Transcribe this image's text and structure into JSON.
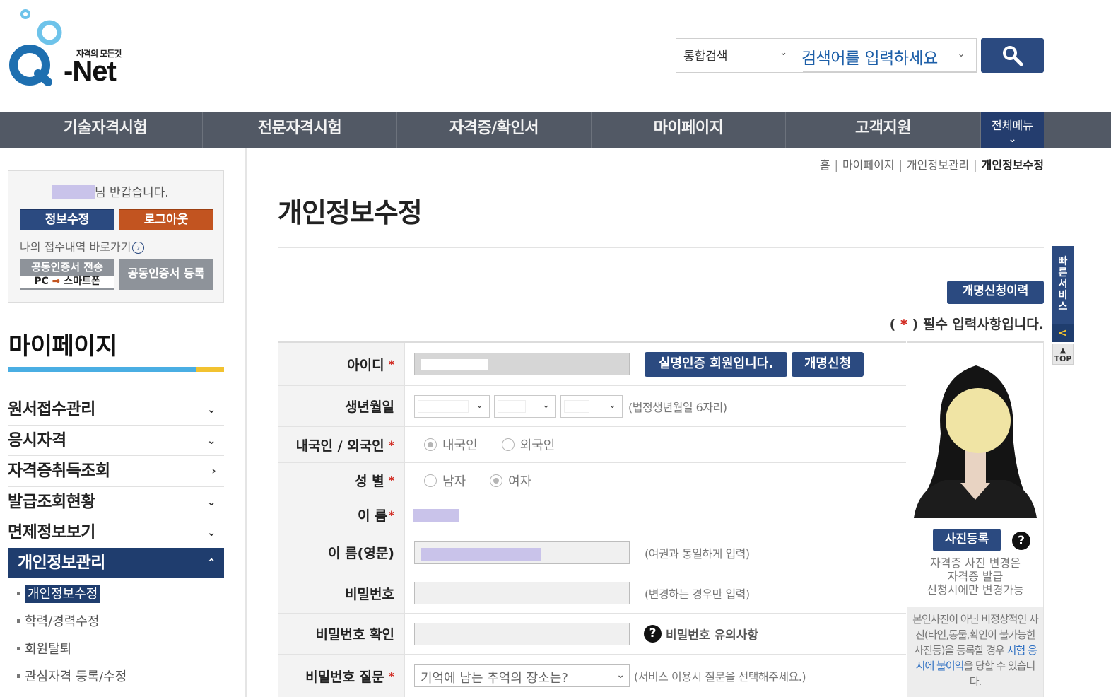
{
  "header": {
    "logo_tag": "자격의 모든것",
    "logo_word": "-Net",
    "search_scope": "통합검색",
    "search_placeholder": "검색어를 입력하세요"
  },
  "gnb": {
    "items": [
      "기술자격시험",
      "전문자격시험",
      "자격증/확인서",
      "마이페이지",
      "고객지원"
    ],
    "all_menu": "전체메뉴"
  },
  "sidebar": {
    "greeting_suffix": "님 반갑습니다.",
    "info_button": "정보수정",
    "logout_button": "로그아웃",
    "receipt_link": "나의 접수내역 바로가기",
    "cert_send_top": "공동인증서 전송",
    "cert_send_pc": "PC",
    "cert_send_phone": "스마트폰",
    "cert_register": "공동인증서 등록",
    "title": "마이페이지",
    "menu": [
      {
        "label": "원서접수관리",
        "chev": "⌄"
      },
      {
        "label": "응시자격",
        "chev": "⌄"
      },
      {
        "label": "자격증취득조회",
        "chev": "›"
      },
      {
        "label": "발급조회현황",
        "chev": "⌄"
      },
      {
        "label": "면제정보보기",
        "chev": "⌄"
      },
      {
        "label": "개인정보관리",
        "chev": "⌃"
      }
    ],
    "submenu": [
      "개인정보수정",
      "학력/경력수정",
      "회원탈퇴",
      "관심자격 등록/수정"
    ]
  },
  "breadcrumb": [
    "홈",
    "마이페이지",
    "개인정보관리",
    "개인정보수정"
  ],
  "page_title": "개인정보수정",
  "rename_history_button": "개명신청이력",
  "required_note": {
    "open": "( ",
    "star": "*",
    "close": " ) 필수 입력사항입니다."
  },
  "form": {
    "id_label": "아이디",
    "real_name_button": "실명인증 회원입니다.",
    "rename_button": "개명신청",
    "birth_label": "생년월일",
    "birth_hint": "(법정생년월일 6자리)",
    "nationality_label": "내국인 / 외국인",
    "nationality_options": [
      "내국인",
      "외국인"
    ],
    "gender_label": "성 별",
    "gender_options": [
      "남자",
      "여자"
    ],
    "name_label": "이 름",
    "name_en_label": "이 름(영문)",
    "name_en_hint": "(여권과 동일하게 입력)",
    "password_label": "비밀번호",
    "password_hint": "(변경하는 경우만 입력)",
    "password_confirm_label": "비밀번호 확인",
    "password_caution": "비밀번호 유의사항",
    "password_question_label": "비밀번호 질문",
    "password_question_value": "기억에 남는 추억의 장소는?",
    "password_question_hint": "(서비스 이용시 질문을 선택해주세요.)",
    "required_mark": "*"
  },
  "photo": {
    "register_button": "사진등록",
    "help": "?",
    "note_lines": [
      "자격증 사진 변경은",
      "자격증 발급",
      "신청시에만 변경가능"
    ],
    "warn_before": "본인사진이 아닌 비정상적인 사진(타인,동물,확인이 불가능한 사진등)을 등록할 경우 ",
    "warn_highlight": "시험 응시에 불이익",
    "warn_after": "을 당할 수 있습니다."
  },
  "quick": {
    "label": "빠른서비스",
    "toggle": "<",
    "top": "TOP"
  },
  "colors": {
    "brand_navy": "#2b4a80",
    "accent_orange": "#c25420",
    "gnb_grey": "#525965",
    "required_red": "#d0241b"
  }
}
